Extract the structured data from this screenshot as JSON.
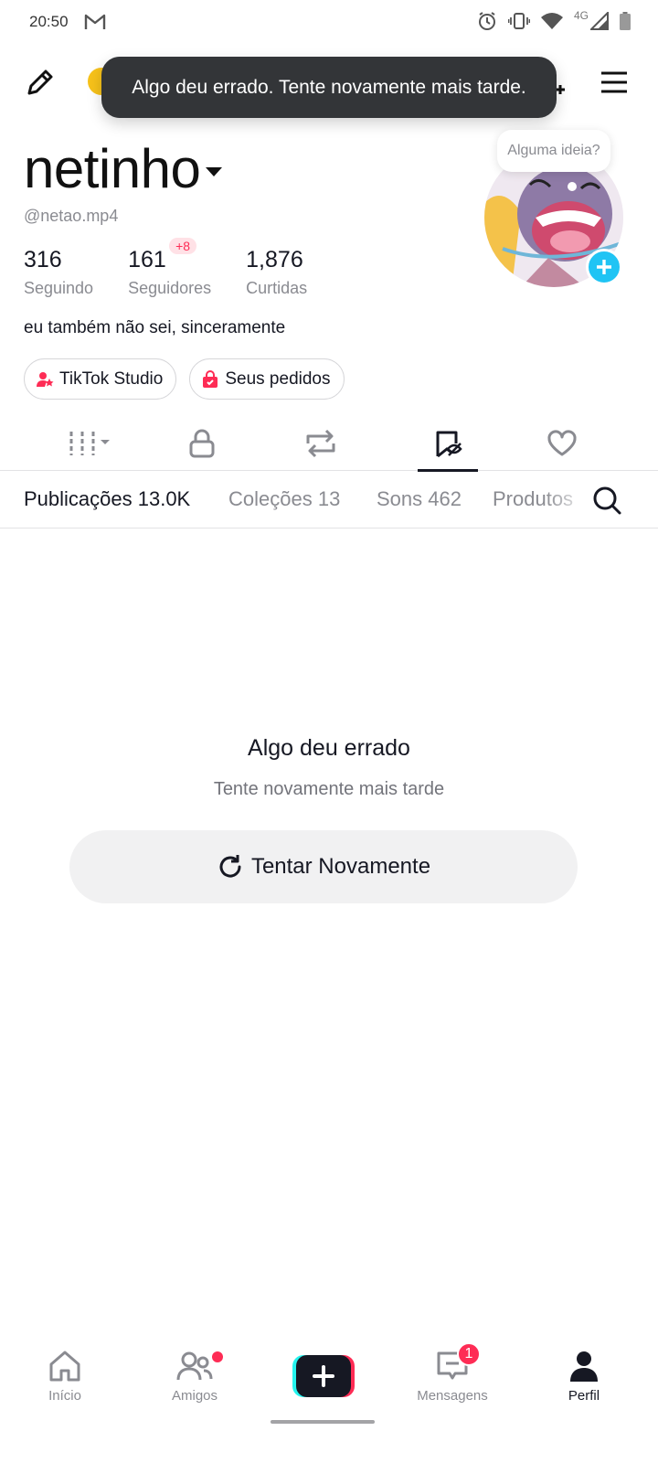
{
  "status_bar": {
    "time": "20:50",
    "network": "4G"
  },
  "toast": {
    "message": "Algo deu errado. Tente novamente mais tarde."
  },
  "profile": {
    "display_name": "netinho",
    "handle": "@netao.mp4",
    "bio": "eu também não sei, sinceramente",
    "stats": [
      {
        "value": "316",
        "label": "Seguindo"
      },
      {
        "value": "161",
        "label": "Seguidores",
        "delta": "+8"
      },
      {
        "value": "1,876",
        "label": "Curtidas"
      }
    ],
    "avatar_bubble": "Alguma ideia?"
  },
  "chips": [
    {
      "label": "TikTok Studio",
      "icon": "tiktok-studio-icon"
    },
    {
      "label": "Seus pedidos",
      "icon": "shopping-bag-icon"
    }
  ],
  "icon_tabs": [
    "grid-icon",
    "lock-icon",
    "repost-icon",
    "saved-icon",
    "heart-icon"
  ],
  "sub_tabs": [
    {
      "label": "Publicações 13.0K",
      "active": true
    },
    {
      "label": "Coleções 13"
    },
    {
      "label": "Sons 462"
    },
    {
      "label": "Produtos"
    }
  ],
  "error_state": {
    "title": "Algo deu errado",
    "subtitle": "Tente novamente mais tarde",
    "retry_label": "Tentar Novamente"
  },
  "bottom_nav": [
    {
      "label": "Início",
      "icon": "home-icon"
    },
    {
      "label": "Amigos",
      "icon": "friends-icon",
      "dot": true
    },
    {
      "label": "",
      "icon": "create-icon"
    },
    {
      "label": "Mensagens",
      "icon": "inbox-icon",
      "badge": "1"
    },
    {
      "label": "Perfil",
      "icon": "profile-icon",
      "active": true
    }
  ],
  "colors": {
    "accent": "#fe2c55",
    "cyan": "#20c4f4",
    "text": "#161823",
    "muted": "#8a8b91"
  }
}
